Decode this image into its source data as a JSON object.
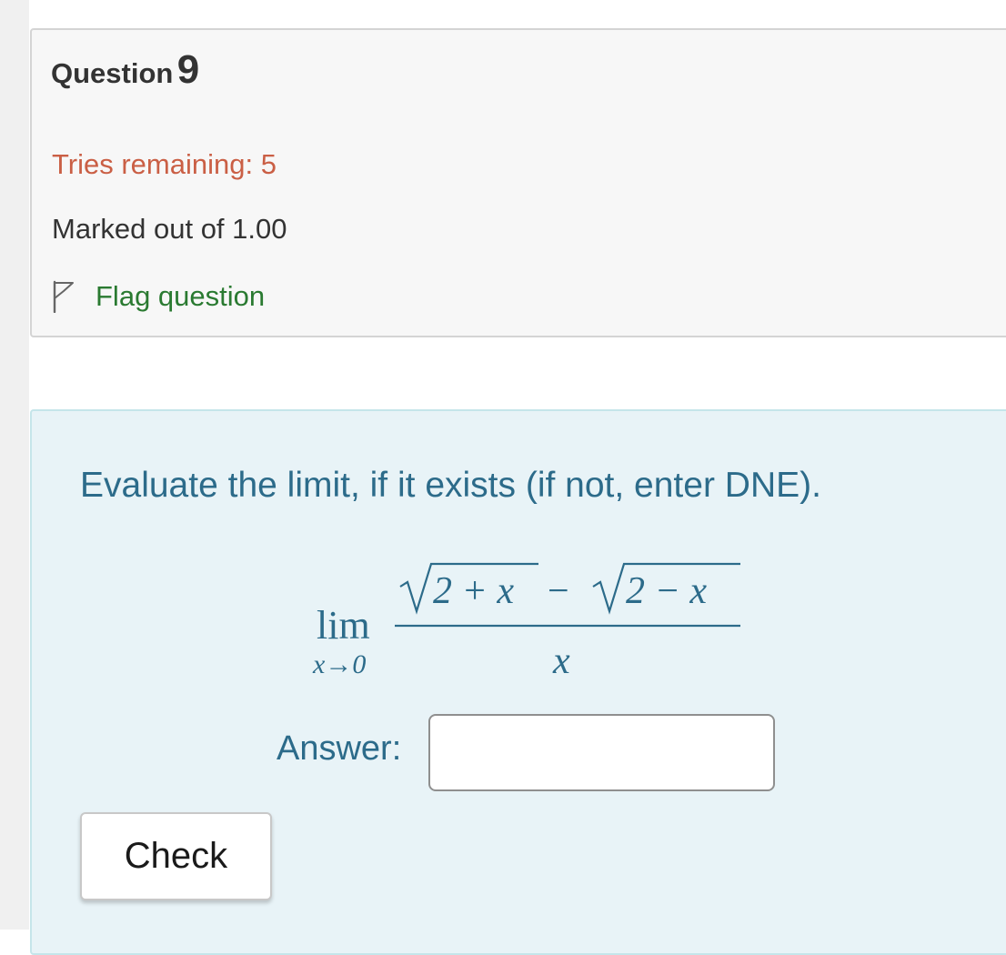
{
  "question": {
    "label": "Question",
    "number": "9",
    "tries_remaining": "Tries remaining: 5",
    "marked_out_of": "Marked out of 1.00",
    "flag_label": "Flag question"
  },
  "content": {
    "prompt": "Evaluate the limit, if it exists (if not, enter DNE).",
    "math": {
      "lim": "lim",
      "approach": "x→0",
      "numerator_left": "2 + x",
      "minus": "−",
      "numerator_right": "2 − x",
      "denominator": "x"
    },
    "answer_label": "Answer:",
    "answer_value": "",
    "check_label": "Check"
  },
  "colors": {
    "tries": "#ca5f45",
    "flag": "#2a7a31",
    "prompt": "#2c6b8a",
    "content_bg": "#e8f3f7"
  },
  "icons": {
    "flag": "flag-outline-icon"
  }
}
